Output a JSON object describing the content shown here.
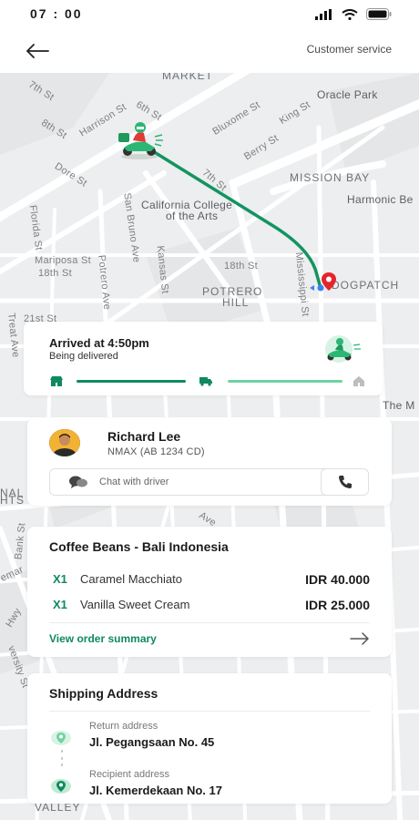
{
  "status_bar": {
    "time": "07 : 00"
  },
  "header": {
    "customer_service": "Customer service"
  },
  "map": {
    "labels": {
      "market": "MARKET",
      "st7": "7th St",
      "st6": "6th St",
      "st8": "8th St",
      "harrison": "Harrison St",
      "bluxome": "Bluxome St",
      "king": "King St",
      "oracle_park": "Oracle Park",
      "berry": "Berry St",
      "dore": "Dore St",
      "mission_bay": "MISSION BAY",
      "harmonic": "Harmonic Be",
      "seventh_partial": "7th St",
      "college": "California College",
      "college2": "of the Arts",
      "florida": "Florida St",
      "san_bruno": "San Bruno Ave",
      "mariposa": "Mariposa St",
      "st18": "18th St",
      "kansas": "Kansas St",
      "st18b": "18th St",
      "mississippi": "Mississippi St",
      "dogpatch": "DOGPATCH",
      "potrero": "POTRERO",
      "hill": "HILL",
      "potrero_ave": "Potrero Ave",
      "st21": "21st St",
      "treat": "Treat Ave",
      "the_m": "The M",
      "nal": "NAL",
      "hts": "HTS",
      "ave": "Ave",
      "bank": "Bank St",
      "emar": "emar",
      "hwy": "Hwy",
      "versity": "versity St",
      "valley": "VALLEY"
    }
  },
  "status_card": {
    "title": "Arrived at 4:50pm",
    "subtitle": "Being delivered"
  },
  "driver": {
    "name": "Richard Lee",
    "vehicle": "NMAX (AB 1234 CD)",
    "chat_label": "Chat with driver"
  },
  "order": {
    "title": "Coffee Beans - Bali Indonesia",
    "items": [
      {
        "qty": "X1",
        "name": "Caramel Macchiato",
        "price": "IDR 40.000"
      },
      {
        "qty": "X1",
        "name": "Vanilla Sweet Cream",
        "price": "IDR 25.000"
      }
    ],
    "view_summary": "View order summary"
  },
  "shipping": {
    "title": "Shipping Address",
    "return_label": "Return address",
    "return_value": "Jl. Pegangsaan No. 45",
    "recipient_label": "Recipient address",
    "recipient_value": "Jl. Kemerdekaan No. 17"
  },
  "colors": {
    "accent": "#0f8a5f",
    "accent_light": "#6fd3a3",
    "route": "#139461",
    "destination": "#e3262b"
  },
  "icons": {
    "back": "arrow-left-icon",
    "chat": "chat-bubbles-icon",
    "call": "phone-icon",
    "summary": "arrow-right-icon"
  }
}
